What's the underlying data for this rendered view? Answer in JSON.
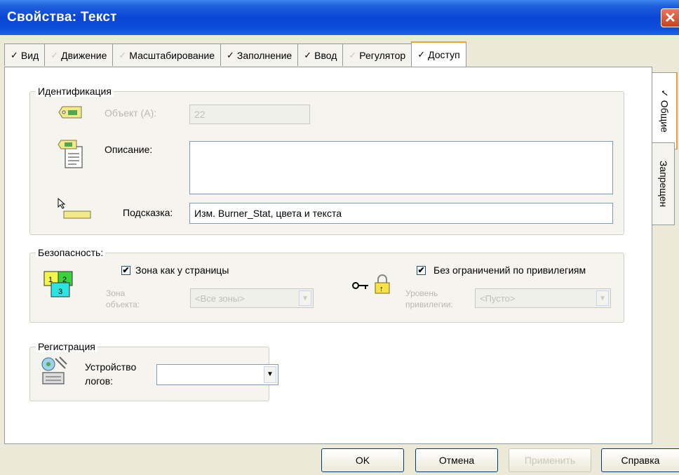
{
  "window": {
    "title": "Свойства: Текст"
  },
  "tabs": [
    {
      "label": "Вид",
      "checked": true
    },
    {
      "label": "Движение",
      "checked": false
    },
    {
      "label": "Масштабирование",
      "checked": false
    },
    {
      "label": "Заполнение",
      "checked": true
    },
    {
      "label": "Ввод",
      "checked": true
    },
    {
      "label": "Регулятор",
      "checked": false
    },
    {
      "label": "Доступ",
      "checked": true,
      "active": true
    }
  ],
  "check_glyph": "✓",
  "side_tabs": [
    {
      "label": "✓ Общие",
      "active": true
    },
    {
      "label": "Запрещен",
      "active": false
    }
  ],
  "identification": {
    "legend": "Идентификация",
    "object_label": "Объект (А):",
    "object_value": "22",
    "description_label": "Описание:",
    "description_value": "",
    "hint_label": "Подсказка:",
    "hint_value": "Изм. Burner_Stat, цвета и текста"
  },
  "security": {
    "legend": "Безопасность:",
    "zone_checkbox_label": "Зона как у страницы",
    "zone_checked": true,
    "object_zone_label_1": "Зона",
    "object_zone_label_2": "объекта:",
    "object_zone_value": "<Все зоны>",
    "privilege_checkbox_label": "Без ограничений по привилегиям",
    "privilege_checked": true,
    "privilege_level_label_1": "Уровень",
    "privilege_level_label_2": "привилегии:",
    "privilege_level_value": "<Пусто>",
    "zone_numbers": [
      "1",
      "2",
      "3"
    ]
  },
  "registration": {
    "legend": "Регистрация",
    "device_label_1": "Устройство",
    "device_label_2": "логов:",
    "device_value": ""
  },
  "buttons": {
    "ok": "OK",
    "cancel": "Отмена",
    "apply": "Применить",
    "help": "Справка"
  },
  "colors": {
    "title_bar": "#0a46d6",
    "active_tab_accent": "#e8a33a",
    "zone_yellow": "#f6f64a",
    "zone_green": "#3cd23c",
    "zone_cyan": "#2fe3e3"
  }
}
